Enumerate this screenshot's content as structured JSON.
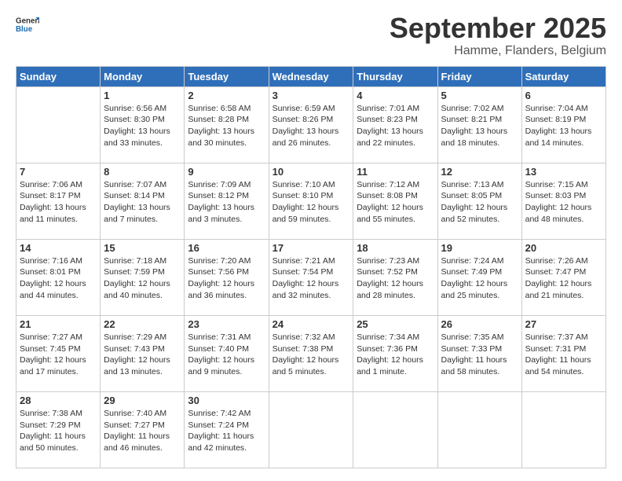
{
  "logo": {
    "line1": "General",
    "line2": "Blue"
  },
  "title": "September 2025",
  "location": "Hamme, Flanders, Belgium",
  "days_header": [
    "Sunday",
    "Monday",
    "Tuesday",
    "Wednesday",
    "Thursday",
    "Friday",
    "Saturday"
  ],
  "weeks": [
    [
      {
        "day": "",
        "info": ""
      },
      {
        "day": "1",
        "info": "Sunrise: 6:56 AM\nSunset: 8:30 PM\nDaylight: 13 hours\nand 33 minutes."
      },
      {
        "day": "2",
        "info": "Sunrise: 6:58 AM\nSunset: 8:28 PM\nDaylight: 13 hours\nand 30 minutes."
      },
      {
        "day": "3",
        "info": "Sunrise: 6:59 AM\nSunset: 8:26 PM\nDaylight: 13 hours\nand 26 minutes."
      },
      {
        "day": "4",
        "info": "Sunrise: 7:01 AM\nSunset: 8:23 PM\nDaylight: 13 hours\nand 22 minutes."
      },
      {
        "day": "5",
        "info": "Sunrise: 7:02 AM\nSunset: 8:21 PM\nDaylight: 13 hours\nand 18 minutes."
      },
      {
        "day": "6",
        "info": "Sunrise: 7:04 AM\nSunset: 8:19 PM\nDaylight: 13 hours\nand 14 minutes."
      }
    ],
    [
      {
        "day": "7",
        "info": "Sunrise: 7:06 AM\nSunset: 8:17 PM\nDaylight: 13 hours\nand 11 minutes."
      },
      {
        "day": "8",
        "info": "Sunrise: 7:07 AM\nSunset: 8:14 PM\nDaylight: 13 hours\nand 7 minutes."
      },
      {
        "day": "9",
        "info": "Sunrise: 7:09 AM\nSunset: 8:12 PM\nDaylight: 13 hours\nand 3 minutes."
      },
      {
        "day": "10",
        "info": "Sunrise: 7:10 AM\nSunset: 8:10 PM\nDaylight: 12 hours\nand 59 minutes."
      },
      {
        "day": "11",
        "info": "Sunrise: 7:12 AM\nSunset: 8:08 PM\nDaylight: 12 hours\nand 55 minutes."
      },
      {
        "day": "12",
        "info": "Sunrise: 7:13 AM\nSunset: 8:05 PM\nDaylight: 12 hours\nand 52 minutes."
      },
      {
        "day": "13",
        "info": "Sunrise: 7:15 AM\nSunset: 8:03 PM\nDaylight: 12 hours\nand 48 minutes."
      }
    ],
    [
      {
        "day": "14",
        "info": "Sunrise: 7:16 AM\nSunset: 8:01 PM\nDaylight: 12 hours\nand 44 minutes."
      },
      {
        "day": "15",
        "info": "Sunrise: 7:18 AM\nSunset: 7:59 PM\nDaylight: 12 hours\nand 40 minutes."
      },
      {
        "day": "16",
        "info": "Sunrise: 7:20 AM\nSunset: 7:56 PM\nDaylight: 12 hours\nand 36 minutes."
      },
      {
        "day": "17",
        "info": "Sunrise: 7:21 AM\nSunset: 7:54 PM\nDaylight: 12 hours\nand 32 minutes."
      },
      {
        "day": "18",
        "info": "Sunrise: 7:23 AM\nSunset: 7:52 PM\nDaylight: 12 hours\nand 28 minutes."
      },
      {
        "day": "19",
        "info": "Sunrise: 7:24 AM\nSunset: 7:49 PM\nDaylight: 12 hours\nand 25 minutes."
      },
      {
        "day": "20",
        "info": "Sunrise: 7:26 AM\nSunset: 7:47 PM\nDaylight: 12 hours\nand 21 minutes."
      }
    ],
    [
      {
        "day": "21",
        "info": "Sunrise: 7:27 AM\nSunset: 7:45 PM\nDaylight: 12 hours\nand 17 minutes."
      },
      {
        "day": "22",
        "info": "Sunrise: 7:29 AM\nSunset: 7:43 PM\nDaylight: 12 hours\nand 13 minutes."
      },
      {
        "day": "23",
        "info": "Sunrise: 7:31 AM\nSunset: 7:40 PM\nDaylight: 12 hours\nand 9 minutes."
      },
      {
        "day": "24",
        "info": "Sunrise: 7:32 AM\nSunset: 7:38 PM\nDaylight: 12 hours\nand 5 minutes."
      },
      {
        "day": "25",
        "info": "Sunrise: 7:34 AM\nSunset: 7:36 PM\nDaylight: 12 hours\nand 1 minute."
      },
      {
        "day": "26",
        "info": "Sunrise: 7:35 AM\nSunset: 7:33 PM\nDaylight: 11 hours\nand 58 minutes."
      },
      {
        "day": "27",
        "info": "Sunrise: 7:37 AM\nSunset: 7:31 PM\nDaylight: 11 hours\nand 54 minutes."
      }
    ],
    [
      {
        "day": "28",
        "info": "Sunrise: 7:38 AM\nSunset: 7:29 PM\nDaylight: 11 hours\nand 50 minutes."
      },
      {
        "day": "29",
        "info": "Sunrise: 7:40 AM\nSunset: 7:27 PM\nDaylight: 11 hours\nand 46 minutes."
      },
      {
        "day": "30",
        "info": "Sunrise: 7:42 AM\nSunset: 7:24 PM\nDaylight: 11 hours\nand 42 minutes."
      },
      {
        "day": "",
        "info": ""
      },
      {
        "day": "",
        "info": ""
      },
      {
        "day": "",
        "info": ""
      },
      {
        "day": "",
        "info": ""
      }
    ]
  ]
}
